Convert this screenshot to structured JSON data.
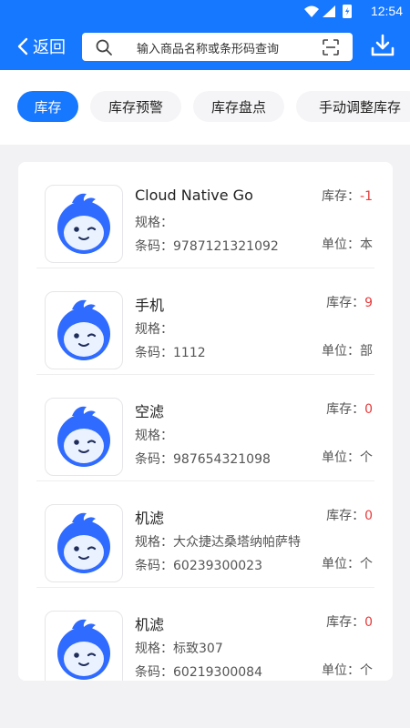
{
  "status": {
    "time": "12:54"
  },
  "header": {
    "back_label": "返回",
    "search_placeholder": "输入商品名称或条形码查询"
  },
  "tabs": [
    {
      "label": "库存",
      "active": true
    },
    {
      "label": "库存预警",
      "active": false
    },
    {
      "label": "库存盘点",
      "active": false
    },
    {
      "label": "手动调整库存",
      "active": false
    }
  ],
  "labels": {
    "spec": "规格：",
    "code": "条码：",
    "stock": "库存：",
    "unit": "单位："
  },
  "items": [
    {
      "name": "Cloud Native Go",
      "spec": "",
      "code": "9787121321092",
      "stock": "-1",
      "unit": "本"
    },
    {
      "name": "手机",
      "spec": "",
      "code": "1112",
      "stock": "9",
      "unit": "部"
    },
    {
      "name": "空滤",
      "spec": "",
      "code": "987654321098",
      "stock": "0",
      "unit": "个"
    },
    {
      "name": "机滤",
      "spec": "大众捷达桑塔纳帕萨特",
      "code": "60239300023",
      "stock": "0",
      "unit": "个"
    },
    {
      "name": "机滤",
      "spec": "标致307",
      "code": "60219300084",
      "stock": "0",
      "unit": "个"
    }
  ],
  "colors": {
    "primary": "#1677ff",
    "stock_value": "#e83a3a"
  }
}
